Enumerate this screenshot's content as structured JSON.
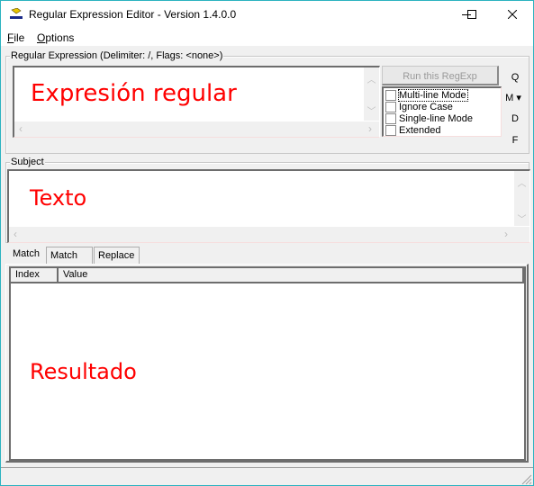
{
  "window": {
    "title": "Regular Expression Editor - Version 1.4.0.0",
    "border_color": "#2bb3c0",
    "controls": [
      "minimize-icon",
      "maximize-icon",
      "close-icon"
    ]
  },
  "menu": {
    "items": [
      {
        "label": "File",
        "accel": "F",
        "rest": "ile"
      },
      {
        "label": "Options",
        "accel": "O",
        "rest": "ptions"
      }
    ]
  },
  "regex_group": {
    "label": "Regular Expression (Delimiter: /, Flags: <none>)",
    "value": "Expresión regular",
    "run_button": "Run this RegExp",
    "options": [
      {
        "label": "Multi-line Mode",
        "checked": false,
        "focused": true
      },
      {
        "label": "Ignore Case",
        "checked": false
      },
      {
        "label": "Single-line Mode",
        "checked": false
      },
      {
        "label": "Extended",
        "checked": false
      }
    ],
    "side_buttons": [
      {
        "label": "Q"
      },
      {
        "label": "M ▾"
      },
      {
        "label": "D"
      },
      {
        "label": "F"
      }
    ]
  },
  "subject_group": {
    "label": "Subject",
    "value": "Texto"
  },
  "tabs": [
    {
      "label": "Match",
      "active": true
    },
    {
      "label": "Match All",
      "active": false
    },
    {
      "label": "Replace",
      "active": false
    }
  ],
  "results": {
    "columns": [
      "Index",
      "Value"
    ],
    "overlay_text": "Resultado",
    "rows": []
  },
  "colors": {
    "annotation_red": "#ff0000"
  }
}
